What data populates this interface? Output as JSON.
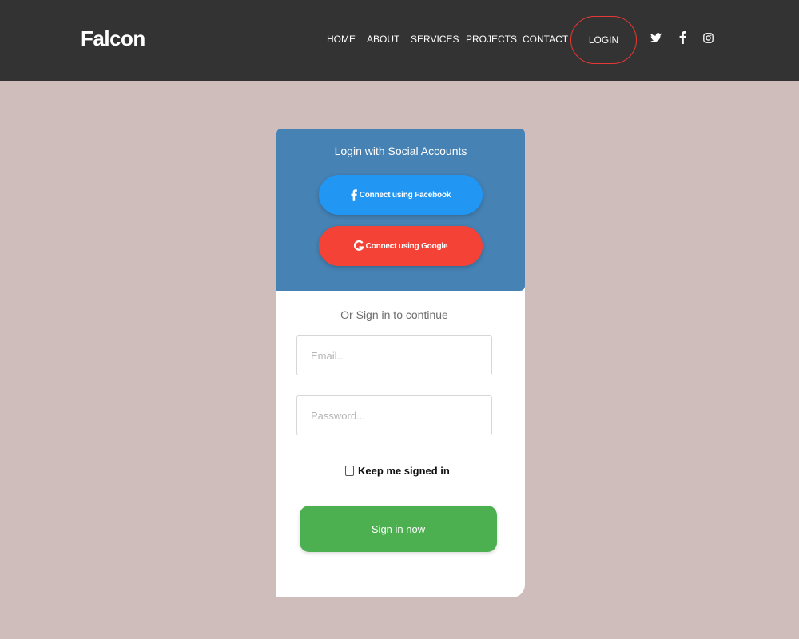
{
  "colors": {
    "navbar_bg": "#333333",
    "page_bg": "#cfbdbb",
    "social_panel_bg": "#4682b4",
    "facebook": "#2196f3",
    "google": "#f44336",
    "signin": "#4caf50",
    "login_border": "#e53935"
  },
  "navbar": {
    "brand": "Falcon",
    "links": [
      "HOME",
      "ABOUT",
      "SERVICES",
      "PROJECTS",
      "CONTACT"
    ],
    "login": "LOGIN",
    "social_icons": [
      "twitter-icon",
      "facebook-icon",
      "instagram-icon"
    ]
  },
  "social_login": {
    "title": "Login with Social Accounts",
    "facebook": {
      "icon": "facebook-icon",
      "label": "Connect using Facebook"
    },
    "google": {
      "icon": "google-icon",
      "label": "Connect using Google"
    }
  },
  "form": {
    "divider_text": "Or Sign in to continue",
    "email": {
      "placeholder": "Email...",
      "value": ""
    },
    "password": {
      "placeholder": "Password...",
      "value": ""
    },
    "remember": {
      "label": "Keep me signed in",
      "checked": false
    },
    "submit": "Sign in now"
  }
}
